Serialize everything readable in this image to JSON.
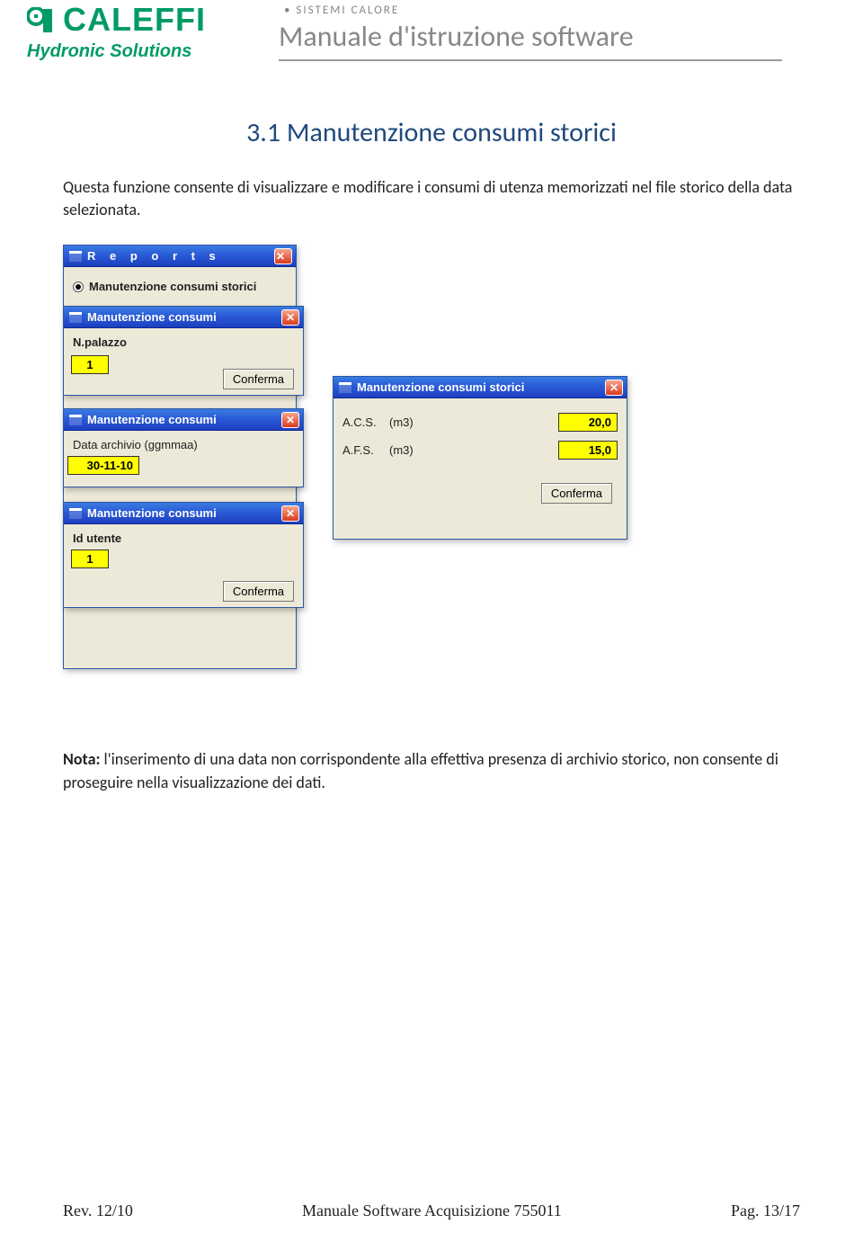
{
  "header": {
    "logo_main": "CALEFFI",
    "logo_sub": "Hydronic Solutions",
    "sistemi": "SISTEMI CALORE",
    "doc_title": "Manuale d'istruzione software"
  },
  "section": {
    "title": "3.1 Manutenzione consumi storici",
    "intro": "Questa funzione consente di visualizzare e modificare i consumi di utenza memorizzati nel file storico della data selezionata.",
    "note_label": "Nota:",
    "note_body": " l'inserimento di una data non corrispondente alla effettiva presenza di archivio storico, non consente di proseguire nella visualizzazione dei dati."
  },
  "windows": {
    "reports": {
      "title": "R e p o r t s",
      "radio": "Manutenzione consumi storici"
    },
    "w1": {
      "title": "Manutenzione consumi",
      "label": "N.palazzo",
      "value": "1",
      "btn": "Conferma"
    },
    "w2": {
      "title": "Manutenzione consumi",
      "label": "Data archivio (ggmmaa)",
      "value": "30-11-10"
    },
    "w3": {
      "title": "Manutenzione consumi",
      "label": "Id utente",
      "value": "1",
      "btn": "Conferma"
    },
    "w4": {
      "title": "Manutenzione consumi storici",
      "row1_label": "A.C.S.",
      "row1_unit": "(m3)",
      "row1_val": "20,0",
      "row2_label": "A.F.S.",
      "row2_unit": "(m3)",
      "row2_val": "15,0",
      "btn": "Conferma"
    },
    "close_label": "✕"
  },
  "footer": {
    "rev": "Rev. 12/10",
    "center": "Manuale Software Acquisizione 755011",
    "page": "Pag. 13/17"
  }
}
